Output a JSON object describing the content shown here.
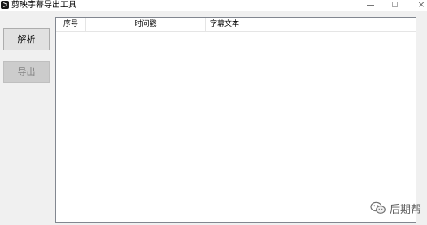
{
  "window": {
    "title": "剪映字幕导出工具",
    "icon": "capcut-logo-icon",
    "controls": [
      "minimize-icon",
      "maximize-icon",
      "close-icon"
    ],
    "close_glyph": "×"
  },
  "buttons": {
    "parse_label": "解析",
    "export_label": "导出"
  },
  "table": {
    "columns": [
      "序号",
      "时间戳",
      "字幕文本"
    ],
    "rows": []
  },
  "watermark": {
    "icon": "wechat-icon",
    "text": "后期帮"
  },
  "colors": {
    "window_bg": "#f0f0f0",
    "titlebar_bg": "#ffffff",
    "list_border": "#828790",
    "button_bg": "#e1e1e1",
    "disabled_button_bg": "#cccccc",
    "disabled_text": "#838383"
  }
}
